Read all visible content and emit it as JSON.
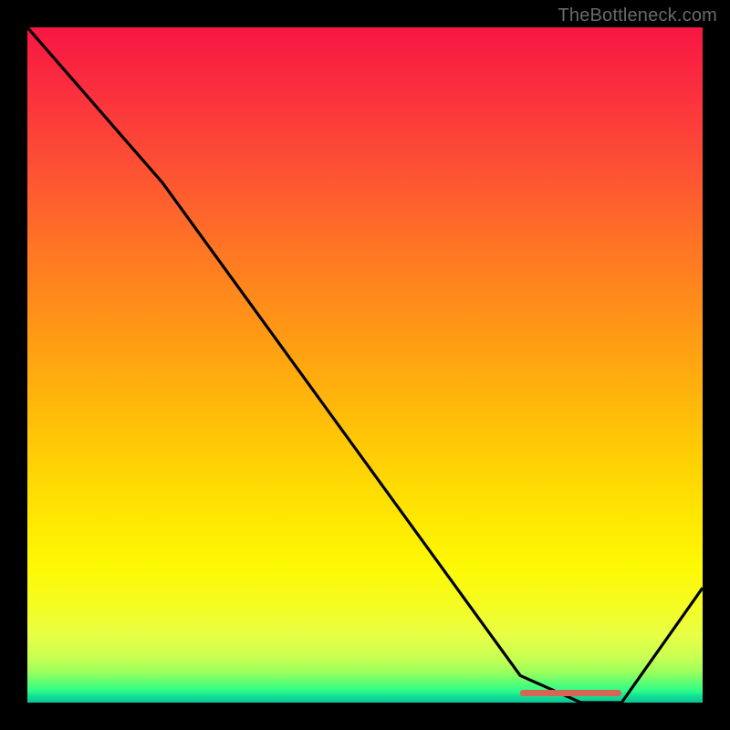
{
  "watermark": "TheBottleneck.com",
  "chart_data": {
    "type": "line",
    "title": "",
    "xlabel": "",
    "ylabel": "",
    "xlim": [
      0,
      100
    ],
    "ylim": [
      0,
      100
    ],
    "series": [
      {
        "name": "bottleneck-curve",
        "x": [
          0,
          20,
          73,
          82,
          88,
          100
        ],
        "y": [
          100,
          77,
          4,
          0,
          0,
          17
        ]
      }
    ],
    "annotations": [
      {
        "name": "optimal-range-bar",
        "x_start": 73,
        "x_end": 88,
        "y": 1.5,
        "color": "#d56656"
      }
    ],
    "gradient_stops": [
      {
        "pct": 0,
        "color": "#f81643"
      },
      {
        "pct": 33,
        "color": "#ff7624"
      },
      {
        "pct": 61,
        "color": "#ffc706"
      },
      {
        "pct": 90,
        "color": "#e8ff46"
      },
      {
        "pct": 100,
        "color": "#08c498"
      }
    ]
  }
}
